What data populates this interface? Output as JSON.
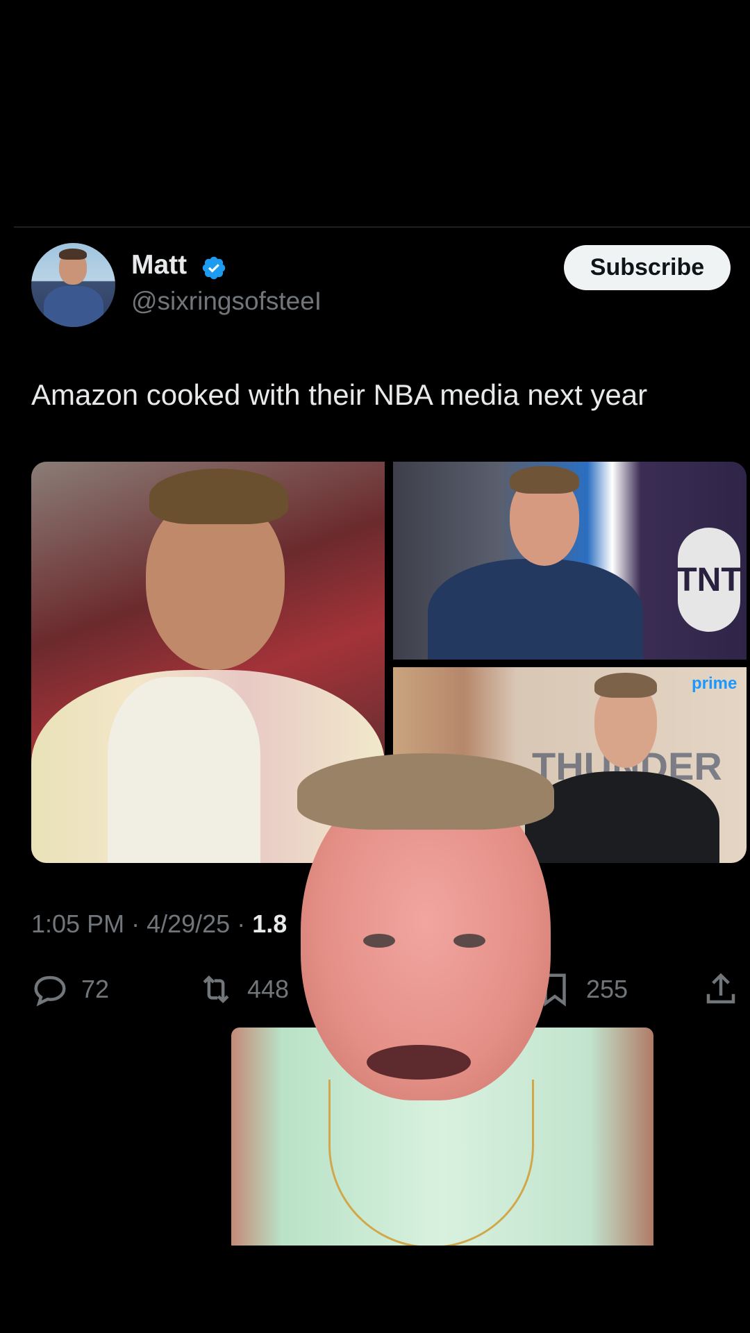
{
  "author": {
    "name": "Matt",
    "handle": "@sixringsofsteeI",
    "verified": true
  },
  "subscribe_label": "Subscribe",
  "tweet_text": "Amazon cooked with their NBA media next year",
  "media": {
    "tnt_logo_text": "TNT",
    "prime_label": "prime",
    "background_text": "THUNDER"
  },
  "meta": {
    "time": "1:05 PM",
    "date": "4/29/25",
    "views_partial": "1.8"
  },
  "actions": {
    "replies": "72",
    "reposts": "448",
    "bookmarks": "255"
  },
  "colors": {
    "background": "#000000",
    "text_primary": "#e7e9ea",
    "text_secondary": "#71767b",
    "verified_blue": "#1d9bf0",
    "subscribe_bg": "#eff3f4"
  },
  "icons": [
    "verified-badge-icon",
    "reply-icon",
    "repost-icon",
    "bookmark-icon",
    "share-icon"
  ]
}
